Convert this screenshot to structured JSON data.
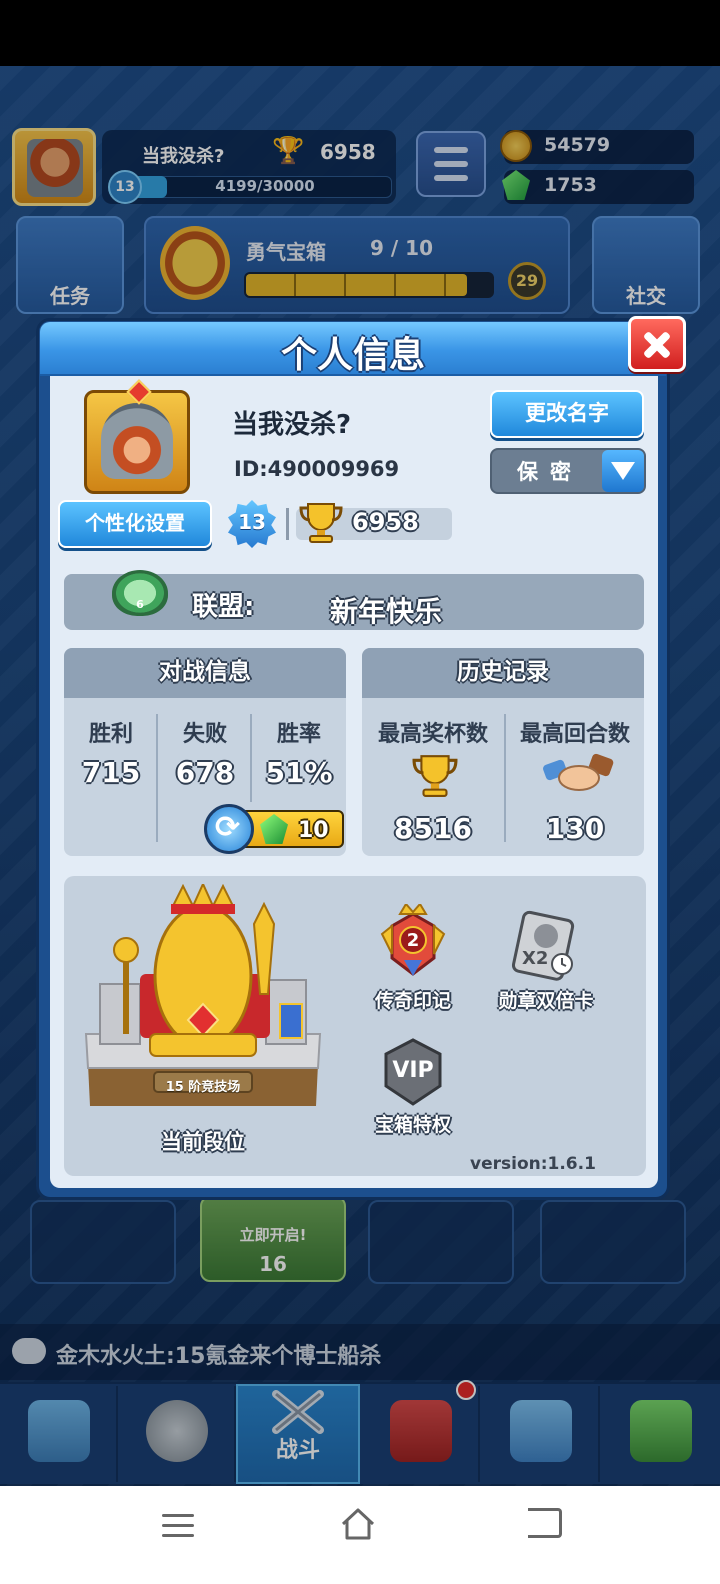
{
  "hud": {
    "player_name": "当我没杀?",
    "trophies": "6958",
    "level": "13",
    "xp": "4199/30000",
    "xp_progress": 0.14,
    "coins": "54579",
    "gems": "1753",
    "task_label": "任务",
    "social_label": "社交",
    "chest_name": "勇气宝箱",
    "chest_count": "9 / 10",
    "chest_progress": 0.9,
    "chest_timer": "29"
  },
  "slots": {
    "open_label": "立即开启!",
    "open_cost": "16"
  },
  "chat": {
    "message": "金木水火土:15氪金来个博士船杀"
  },
  "tabs": {
    "battle_label": "战斗"
  },
  "dialog": {
    "title": "个人信息",
    "name": "当我没杀?",
    "id": "ID:490009969",
    "rename_label": "更改名字",
    "privacy_label": "保密",
    "customize_label": "个性化设置",
    "level": "13",
    "trophies": "6958",
    "alliance_label": "联盟:",
    "alliance_name": "新年快乐",
    "alliance_badge_num": "6",
    "battle_info": {
      "title": "对战信息",
      "columns": [
        {
          "label": "胜利",
          "value": "715"
        },
        {
          "label": "失败",
          "value": "678"
        },
        {
          "label": "胜率",
          "value": "51%"
        }
      ],
      "refresh_cost": "10"
    },
    "history": {
      "title": "历史记录",
      "columns": [
        {
          "label": "最高奖杯数",
          "value": "8516"
        },
        {
          "label": "最高回合数",
          "value": "130"
        }
      ]
    },
    "rank": {
      "label": "当前段位",
      "banner": "15 阶竞技场"
    },
    "badges": [
      {
        "label": "传奇印记",
        "num": "2"
      },
      {
        "label": "勋章双倍卡",
        "mark": "X2"
      },
      {
        "label": "宝箱特权",
        "mark": "VIP"
      }
    ],
    "version": "version:1.6.1"
  },
  "colors": {
    "accent_blue": "#2088db",
    "close_red": "#d11f1f",
    "panel_bg": "#e3ecf6",
    "gold": "#f3c12d"
  }
}
